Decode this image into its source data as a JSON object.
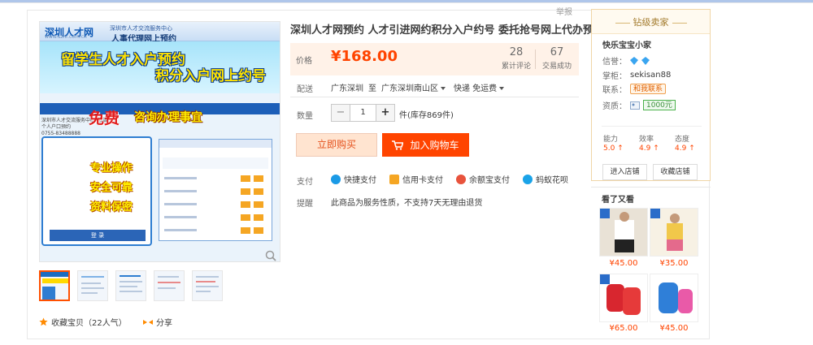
{
  "report_label": "举报",
  "main_image": {
    "logo": "深圳人才网",
    "logo_url": "www.szhr.com.cn",
    "center": "深圳市人才交流服务中心",
    "service": "人事代理网上预约",
    "headline1": "留学生人才入户预约",
    "headline2": "积分入户网上约号",
    "free": "免费",
    "free_rest": "咨询办理事宜",
    "slogan1": "专业操作",
    "slogan2": "安全可靠",
    "slogan3": "资料保密",
    "login_label": "登  录",
    "doc_text": "深圳市人才交流服务中心(总部)\n个人户口预约\n0755-83488888"
  },
  "actions": {
    "favorite": "收藏宝贝（22人气）",
    "share": "分享"
  },
  "product": {
    "title": "深圳人才网预约 人才引进网约积分入户约号 委托抢号网上代办预约",
    "price_label": "价格",
    "price": "¥168.00",
    "reviews_count": "28",
    "reviews_label": "累计评论",
    "sales_count": "67",
    "sales_label": "交易成功",
    "ship_label": "配送",
    "ship_from": "广东深圳",
    "ship_to_word": "至",
    "ship_to": "广东深圳南山区",
    "ship_fee": "快递 免运费",
    "qty_label": "数量",
    "qty_value": "1",
    "qty_minus": "−",
    "qty_plus": "+",
    "stock": "件(库存869件)",
    "buy_now": "立即购买",
    "add_cart": "加入购物车",
    "pay_label": "支付",
    "pay_methods": [
      "快捷支付",
      "信用卡支付",
      "余额宝支付",
      "蚂蚁花呗"
    ],
    "remind_label": "提醒",
    "remind_text": "此商品为服务性质，不支持7天无理由退货"
  },
  "seller": {
    "level": "钻级卖家",
    "shop_name": "快乐宝宝小家",
    "credit_label": "信誉：",
    "owner_label": "掌柜：",
    "owner": "sekisan88",
    "contact_label": "联系：",
    "contact": "和我联系",
    "qual_label": "资质：",
    "qual_amount": "1000元",
    "score_labels": [
      "能力",
      "效率",
      "态度"
    ],
    "score_values": [
      "5.0",
      "4.9",
      "4.9"
    ],
    "enter_shop": "进入店铺",
    "fav_shop": "收藏店铺"
  },
  "also_viewed": {
    "title": "看了又看",
    "prices": [
      "¥45.00",
      "¥35.00",
      "¥65.00",
      "¥45.00"
    ]
  },
  "colors": {
    "price": "#ff4400",
    "accent": "#ff4400",
    "seller_border": "#f0d5a6"
  }
}
